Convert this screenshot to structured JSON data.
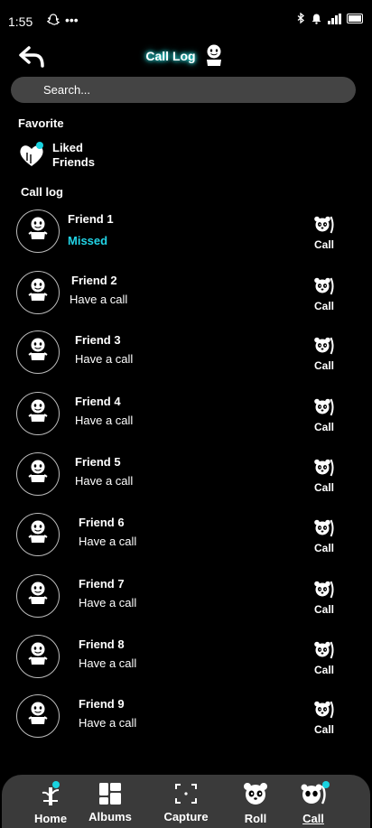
{
  "status": {
    "time": "1:55",
    "dots": "•••"
  },
  "header": {
    "title": "Call Log"
  },
  "search": {
    "placeholder": "Search..."
  },
  "favorite": {
    "heading": "Favorite",
    "label_line1": "Liked",
    "label_line2": "Friends"
  },
  "call_log": {
    "heading": "Call log",
    "call_label": "Call",
    "items": [
      {
        "name": "Friend 1",
        "status": "Missed"
      },
      {
        "name": "Friend 2",
        "status": "Have a call"
      },
      {
        "name": "Friend 3",
        "status": "Have a call"
      },
      {
        "name": "Friend 4",
        "status": "Have a call"
      },
      {
        "name": "Friend 5",
        "status": "Have a call"
      },
      {
        "name": "Friend 6",
        "status": "Have a call"
      },
      {
        "name": "Friend 7",
        "status": "Have a call"
      },
      {
        "name": "Friend 8",
        "status": "Have a call"
      },
      {
        "name": "Friend 9",
        "status": "Have a call"
      }
    ]
  },
  "nav": [
    {
      "label": "Home",
      "icon": "home-icon"
    },
    {
      "label": "Albums",
      "icon": "albums-icon"
    },
    {
      "label": "Capture",
      "icon": "capture-icon"
    },
    {
      "label": "Roll",
      "icon": "roll-icon"
    },
    {
      "label": "Call",
      "icon": "call-icon",
      "active": true
    }
  ],
  "colors": {
    "accent": "#19d3e0",
    "background": "#000000",
    "nav_bg": "#3a3a3a",
    "search_bg": "#444444"
  }
}
